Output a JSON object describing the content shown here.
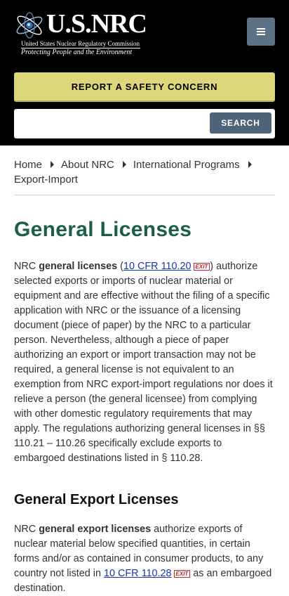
{
  "header": {
    "logo_title": "U.S.NRC",
    "logo_subtitle": "United States Nuclear Regulatory Commission",
    "logo_tagline": "Protecting People and the Environment",
    "menu_icon": "hamburger-icon",
    "report_label": "REPORT A SAFETY CONCERN",
    "search_placeholder": "",
    "search_value": "",
    "search_label": "SEARCH",
    "colors": {
      "background": "#000000",
      "report": "#ddd67a",
      "button": "#4f6478"
    }
  },
  "breadcrumb": {
    "items": [
      "Home",
      "About NRC",
      "International Programs",
      "Export-Import"
    ]
  },
  "main": {
    "title": "General Licenses",
    "title_color": "#1a5e4b",
    "p1": {
      "a": "NRC ",
      "b": "general licenses",
      "c": " (",
      "link": "10 CFR 110.20",
      "exit": "EXIT",
      "d": ") authorize selected exports or imports of nuclear material or equipment and are effective without the filing of a specific application with NRC or the issuance of a licensing document (piece of paper) by the NRC to a particular person. Nevertheless, although a piece of paper authorizing an export or import transaction may not be required, a general license is not equivalent to an exemption from NRC export-import regulations nor does it relieve a person (the general licensee) from complying with other domestic regulatory requirements that may apply. The regulations authorizing general licenses in §§ 110.21 – 110.26 specifically exclude exports to embargoed destinations listed in § 110.28."
    },
    "section_heading": "General Export Licenses",
    "p2": {
      "a": "NRC ",
      "b": "general export licenses",
      "c": " authorize exports of nuclear material below specified quantities, in certain forms and/or as contained in consumer products, to any country not listed in ",
      "link": "10 CFR 110.28",
      "exit": "EXIT",
      "d": " as an embargoed destination."
    }
  }
}
